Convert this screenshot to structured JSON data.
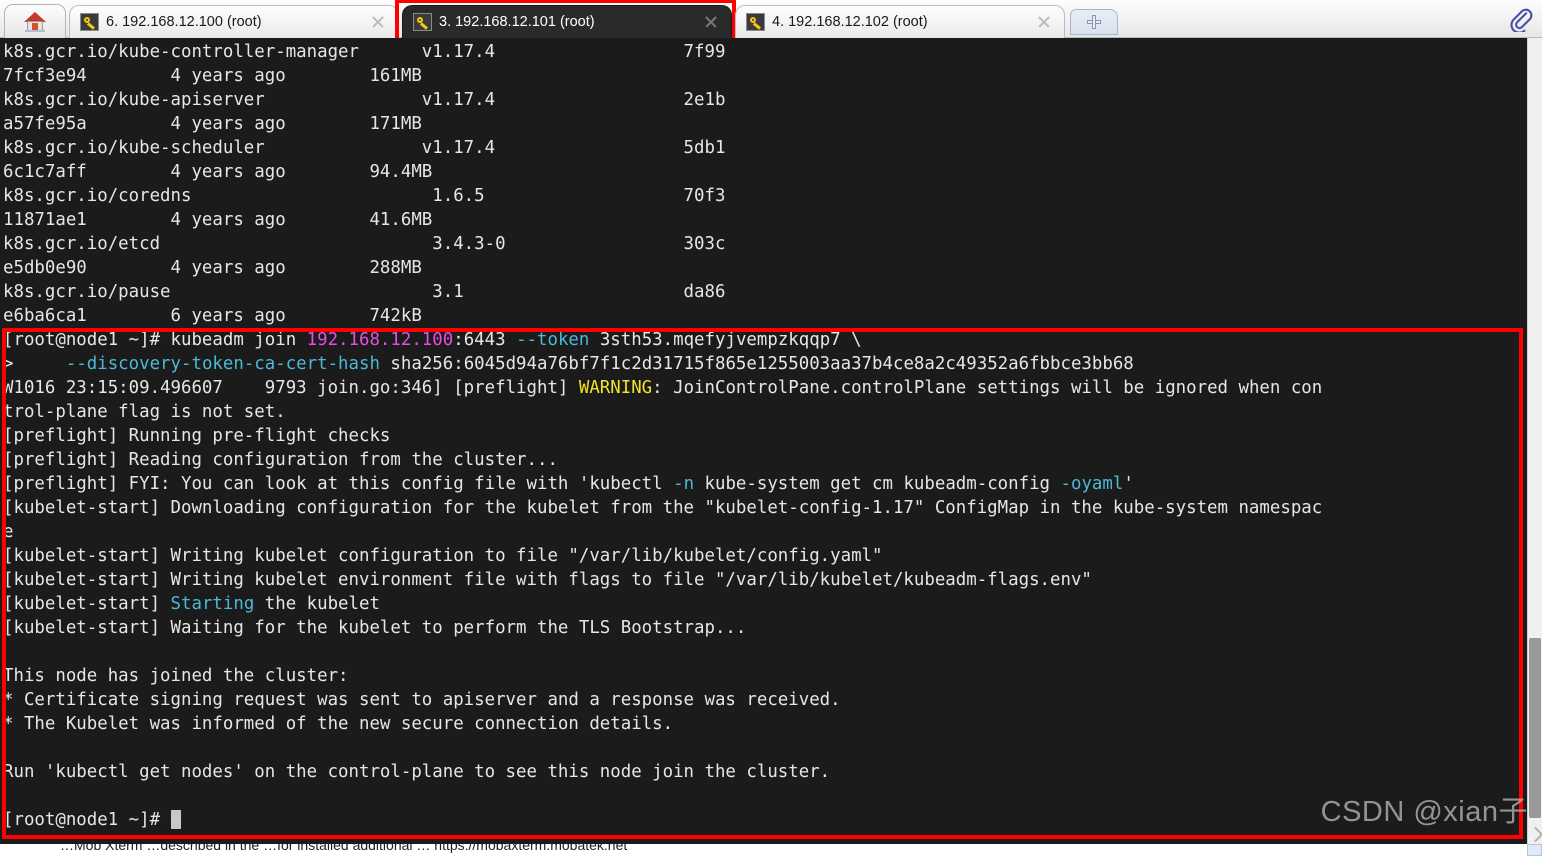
{
  "window": {
    "home_tab_icon": "house-icon",
    "attach_icon": "paperclip-icon",
    "new_tab_icon": "plus-icon"
  },
  "tabs": [
    {
      "label": "6. 192.168.12.100 (root)",
      "icon": "key-icon",
      "active": false,
      "highlighted": false
    },
    {
      "label": "3. 192.168.12.101 (root)",
      "icon": "key-icon",
      "active": true,
      "highlighted": true
    },
    {
      "label": "4. 192.168.12.102 (root)",
      "icon": "key-icon",
      "active": false,
      "highlighted": false
    }
  ],
  "terminal": {
    "background": "#1b1b1b",
    "foreground": "#e6e6e6",
    "accent_cyan": "#4bb8d8",
    "accent_magenta": "#e44ee4",
    "accent_yellow": "#f2e22a",
    "highlight_box_color": "#ff0000",
    "lines": [
      {
        "id": "img-l1",
        "segments": [
          {
            "t": "k8s.gcr.io/kube-controller-manager      v1.17.4                  7f99",
            "c": "white"
          }
        ]
      },
      {
        "id": "img-l2",
        "segments": [
          {
            "t": "7fcf3e94        4 years ago        161MB",
            "c": "white"
          }
        ]
      },
      {
        "id": "img-l3",
        "segments": [
          {
            "t": "k8s.gcr.io/kube-apiserver               v1.17.4                  2e1b",
            "c": "white"
          }
        ]
      },
      {
        "id": "img-l4",
        "segments": [
          {
            "t": "a57fe95a        4 years ago        171MB",
            "c": "white"
          }
        ]
      },
      {
        "id": "img-l5",
        "segments": [
          {
            "t": "k8s.gcr.io/kube-scheduler               v1.17.4                  5db1",
            "c": "white"
          }
        ]
      },
      {
        "id": "img-l6",
        "segments": [
          {
            "t": "6c1c7aff        4 years ago        94.4MB",
            "c": "white"
          }
        ]
      },
      {
        "id": "img-l7",
        "segments": [
          {
            "t": "k8s.gcr.io/coredns                       1.6.5                   70f3",
            "c": "white"
          }
        ]
      },
      {
        "id": "img-l8",
        "segments": [
          {
            "t": "11871ae1        4 years ago        41.6MB",
            "c": "white"
          }
        ]
      },
      {
        "id": "img-l9",
        "segments": [
          {
            "t": "k8s.gcr.io/etcd                          3.4.3-0                 303c",
            "c": "white"
          }
        ]
      },
      {
        "id": "img-l10",
        "segments": [
          {
            "t": "e5db0e90        4 years ago        288MB",
            "c": "white"
          }
        ]
      },
      {
        "id": "img-l11",
        "segments": [
          {
            "t": "k8s.gcr.io/pause                         3.1                     da86",
            "c": "white"
          }
        ]
      },
      {
        "id": "img-l12",
        "segments": [
          {
            "t": "e6ba6ca1        6 years ago        742kB",
            "c": "white"
          }
        ]
      },
      {
        "id": "join-l1",
        "segments": [
          {
            "t": "[root@node1 ~]# kubeadm join ",
            "c": "white"
          },
          {
            "t": "192.168.12.100",
            "c": "magenta"
          },
          {
            "t": ":6443 ",
            "c": "white"
          },
          {
            "t": "--token",
            "c": "cyan"
          },
          {
            "t": " 3sth53.mqefyjvempzkqqp7 \\",
            "c": "white"
          }
        ]
      },
      {
        "id": "join-l2",
        "segments": [
          {
            "t": ">     ",
            "c": "white"
          },
          {
            "t": "--discovery-token-ca-cert-hash",
            "c": "cyan"
          },
          {
            "t": " sha256:6045d94a76bf7f1c2d31715f865e1255003aa37b4ce8a2c49352a6fbbce3bb68",
            "c": "white"
          }
        ]
      },
      {
        "id": "join-l3",
        "segments": [
          {
            "t": "W1016 23:15:09.496607    9793 join.go:346] [preflight] ",
            "c": "white"
          },
          {
            "t": "WARNING",
            "c": "yellow"
          },
          {
            "t": ": JoinControlPane.controlPlane settings will be ignored when con",
            "c": "white"
          }
        ]
      },
      {
        "id": "join-l4",
        "segments": [
          {
            "t": "trol-plane flag is not set.",
            "c": "white"
          }
        ]
      },
      {
        "id": "join-l5",
        "segments": [
          {
            "t": "[preflight] Running pre-flight checks",
            "c": "white"
          }
        ]
      },
      {
        "id": "join-l6",
        "segments": [
          {
            "t": "[preflight] Reading configuration from the cluster...",
            "c": "white"
          }
        ]
      },
      {
        "id": "join-l7",
        "segments": [
          {
            "t": "[preflight] FYI: You can look at this config file with 'kubectl ",
            "c": "white"
          },
          {
            "t": "-n",
            "c": "cyan"
          },
          {
            "t": " kube-system get cm kubeadm-config ",
            "c": "white"
          },
          {
            "t": "-oyaml",
            "c": "cyan"
          },
          {
            "t": "'",
            "c": "white"
          }
        ]
      },
      {
        "id": "join-l8",
        "segments": [
          {
            "t": "[kubelet-start] Downloading configuration for the kubelet from the \"kubelet-config-1.17\" ConfigMap in the kube-system namespac",
            "c": "white"
          }
        ]
      },
      {
        "id": "join-l9",
        "segments": [
          {
            "t": "e",
            "c": "white"
          }
        ]
      },
      {
        "id": "join-l10",
        "segments": [
          {
            "t": "[kubelet-start] Writing kubelet configuration to file \"/var/lib/kubelet/config.yaml\"",
            "c": "white"
          }
        ]
      },
      {
        "id": "join-l11",
        "segments": [
          {
            "t": "[kubelet-start] Writing kubelet environment file with flags to file \"/var/lib/kubelet/kubeadm-flags.env\"",
            "c": "white"
          }
        ]
      },
      {
        "id": "join-l12",
        "segments": [
          {
            "t": "[kubelet-start] ",
            "c": "white"
          },
          {
            "t": "Starting",
            "c": "cyan"
          },
          {
            "t": " the kubelet",
            "c": "white"
          }
        ]
      },
      {
        "id": "join-l13",
        "segments": [
          {
            "t": "[kubelet-start] Waiting for the kubelet to perform the TLS Bootstrap...",
            "c": "white"
          }
        ]
      },
      {
        "id": "join-l14",
        "segments": [
          {
            "t": "",
            "c": "white"
          }
        ]
      },
      {
        "id": "join-l15",
        "segments": [
          {
            "t": "This node has joined the cluster:",
            "c": "white"
          }
        ]
      },
      {
        "id": "join-l16",
        "segments": [
          {
            "t": "* Certificate signing request was sent to apiserver and a response was received.",
            "c": "white"
          }
        ]
      },
      {
        "id": "join-l17",
        "segments": [
          {
            "t": "* The Kubelet was informed of the new secure connection details.",
            "c": "white"
          }
        ]
      },
      {
        "id": "join-l18",
        "segments": [
          {
            "t": "",
            "c": "white"
          }
        ]
      },
      {
        "id": "join-l19",
        "segments": [
          {
            "t": "Run 'kubectl get nodes' on the control-plane to see this node join the cluster.",
            "c": "white"
          }
        ]
      },
      {
        "id": "join-l20",
        "segments": [
          {
            "t": "",
            "c": "white"
          }
        ]
      }
    ],
    "prompt": "[root@node1 ~]# "
  },
  "watermark": {
    "text": "CSDN @xian子"
  },
  "bottom_strip": {
    "text": "…Mob Xterm …described in the …for installed additional … https://mobaxterm.mobatek.net"
  }
}
